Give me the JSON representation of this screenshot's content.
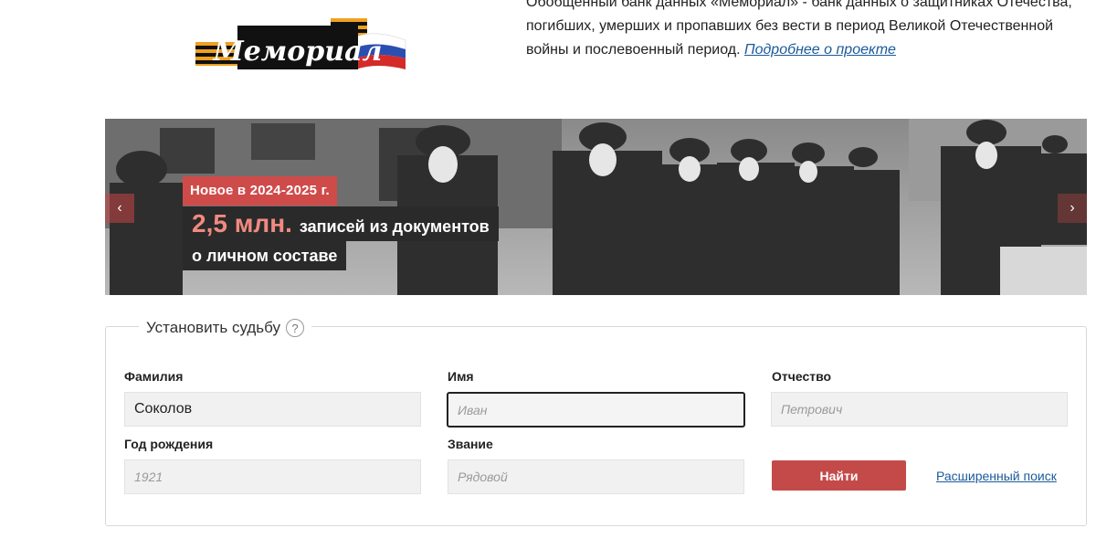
{
  "header": {
    "logo_text": "Мемориал",
    "intro_text": "Обобщенный банк данных «Мемориал» - банк данных о защитниках Отечества, погибших, умерших и пропавших без вести в период Великой Отечественной войны и послевоенный период.",
    "intro_link": "Подробнее о проекте"
  },
  "banner": {
    "badge": "Новое в 2024-2025 г.",
    "highlight": "2,5 млн.",
    "headline_rest": "записей из документов",
    "subline": "о личном составе",
    "arrow_left": "‹",
    "arrow_right": "›"
  },
  "search": {
    "legend": "Установить судьбу",
    "help": "?",
    "surname_label": "Фамилия",
    "surname_value": "Соколов",
    "name_label": "Имя",
    "name_placeholder": "Иван",
    "patronymic_label": "Отчество",
    "patronymic_placeholder": "Петрович",
    "birth_year_label": "Год рождения",
    "birth_year_placeholder": "1921",
    "rank_label": "Звание",
    "rank_placeholder": "Рядовой",
    "find_button": "Найти",
    "advanced_link": "Расширенный поиск"
  },
  "colors": {
    "accent": "#c44a4a",
    "link": "#1a5a9a"
  }
}
